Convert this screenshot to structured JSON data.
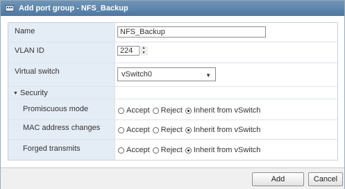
{
  "window": {
    "title": "Add port group - NFS_Backup",
    "icon": "network-icon"
  },
  "form": {
    "name_label": "Name",
    "name_value": "NFS_Backup",
    "vlan_label": "VLAN ID",
    "vlan_value": "224",
    "vswitch_label": "Virtual switch",
    "vswitch_value": "vSwitch0",
    "security_label": "Security",
    "security": [
      {
        "label": "Promiscuous mode",
        "options": [
          "Accept",
          "Reject",
          "Inherit from vSwitch"
        ],
        "selected": "Inherit from vSwitch"
      },
      {
        "label": "MAC address changes",
        "options": [
          "Accept",
          "Reject",
          "Inherit from vSwitch"
        ],
        "selected": "Inherit from vSwitch"
      },
      {
        "label": "Forged transmits",
        "options": [
          "Accept",
          "Reject",
          "Inherit from vSwitch"
        ],
        "selected": "Inherit from vSwitch"
      }
    ]
  },
  "footer": {
    "add_label": "Add",
    "cancel_label": "Cancel"
  }
}
